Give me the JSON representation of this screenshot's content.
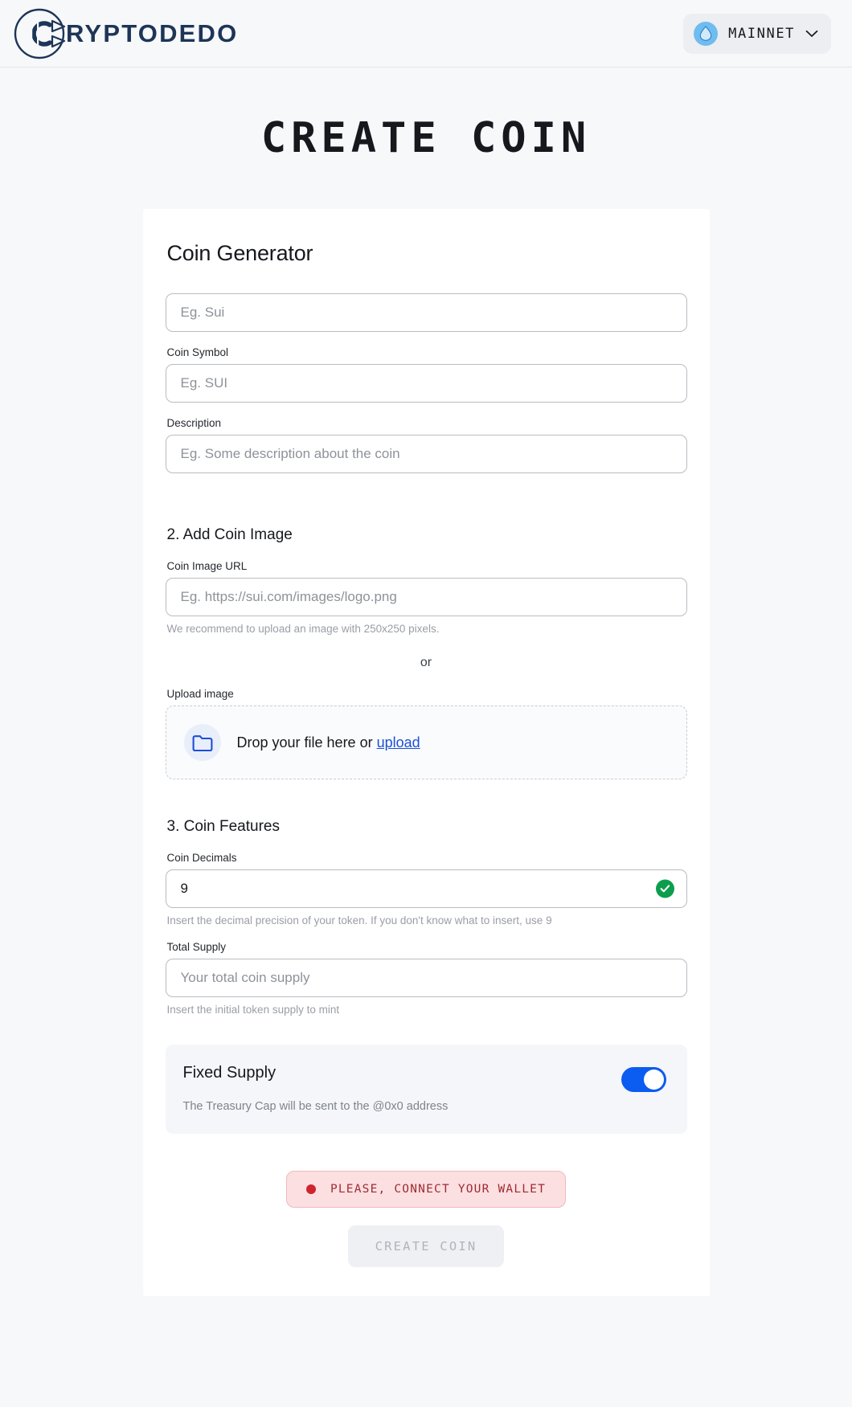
{
  "header": {
    "brand_name": "RYPTODEDO",
    "brand_icon": "cryptodedo-c-logo",
    "network": {
      "label": "MAINNET",
      "icon": "sui-droplet-icon",
      "chevron_icon": "chevron-down-icon",
      "badge_color": "#6fbcf0"
    }
  },
  "page": {
    "title": "CREATE COIN"
  },
  "card": {
    "title": "Coin Generator",
    "section1": {
      "name_field": {
        "placeholder": "Eg. Sui",
        "value": ""
      },
      "symbol_field": {
        "label": "Coin Symbol",
        "placeholder": "Eg. SUI",
        "value": ""
      },
      "description_field": {
        "label": "Description",
        "placeholder": "Eg. Some description about the coin",
        "value": ""
      }
    },
    "section2": {
      "title": "2. Add Coin Image",
      "url_field": {
        "label": "Coin Image URL",
        "placeholder": "Eg. https://sui.com/images/logo.png",
        "value": "",
        "hint": "We recommend to upload an image with 250x250 pixels."
      },
      "or_text": "or",
      "upload": {
        "label": "Upload image",
        "icon": "folder-icon",
        "drop_text": "Drop your file here or ",
        "link_text": "upload"
      }
    },
    "section3": {
      "title": "3. Coin Features",
      "decimals_field": {
        "label": "Coin Decimals",
        "value": "9",
        "placeholder": "9",
        "hint": "Insert the decimal precision of your token. If you don't know what to insert, use 9",
        "valid_icon": "check-circle-icon",
        "valid_color": "#0d9e4d"
      },
      "supply_field": {
        "label": "Total Supply",
        "placeholder": "Your total coin supply",
        "value": "",
        "hint": "Insert the initial token supply to mint"
      },
      "fixed_supply": {
        "title": "Fixed Supply",
        "subtitle": "The Treasury Cap will be sent to the @0x0 address",
        "toggle_on": true,
        "toggle_color": "#0b5cf0"
      }
    },
    "actions": {
      "wallet_warning": "PLEASE, CONNECT YOUR WALLET",
      "wallet_warning_icon": "alert-dot-icon",
      "wallet_warning_color": "#9e2b32",
      "create_button": "CREATE COIN",
      "create_button_disabled": true
    }
  }
}
